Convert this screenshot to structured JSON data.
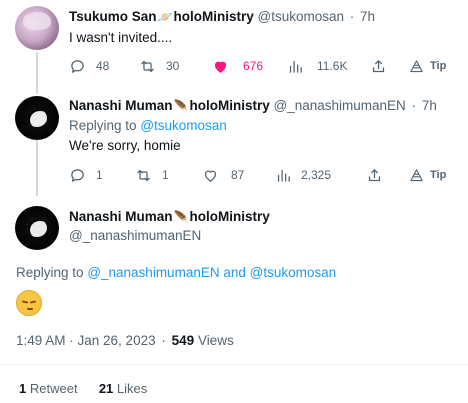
{
  "tweets": [
    {
      "name": "Tsukumo San",
      "name_emoji": "🪐",
      "name_suffix": "holoMinistry",
      "handle": "@tsukomosan",
      "time": "7h",
      "text": "I wasn't invited....",
      "actions": {
        "replies": "48",
        "retweets": "30",
        "likes": "676",
        "views": "11.6K",
        "tip": "Tip"
      }
    },
    {
      "name": "Nanashi Muman",
      "name_emoji": "🪶",
      "name_suffix": "holoMinistry",
      "handle": "@_nanashimumanEN",
      "time": "7h",
      "replying_label": "Replying to",
      "replying_to": "@tsukomosan",
      "text": "We're sorry, homie",
      "actions": {
        "replies": "1",
        "retweets": "1",
        "likes": "87",
        "views": "2,325",
        "tip": "Tip"
      }
    }
  ],
  "main": {
    "name": "Nanashi Muman",
    "name_emoji": "🪶",
    "name_suffix": "holoMinistry",
    "handle": "@_nanashimumanEN",
    "replying_label": "Replying to",
    "replying_to_1": "@_nanashimumanEN",
    "replying_and": "and",
    "replying_to_2": "@tsukomosan",
    "content_emoji": "pensive-face",
    "timestamp": "1:49 AM · Jan 26, 2023",
    "views_count": "549",
    "views_label": "Views",
    "retweets_count": "1",
    "retweets_label": "Retweet",
    "likes_count": "21",
    "likes_label": "Likes"
  },
  "colors": {
    "accent": "#1d9bf0",
    "like": "#f91880",
    "muted": "#536471",
    "text": "#0f1419"
  }
}
